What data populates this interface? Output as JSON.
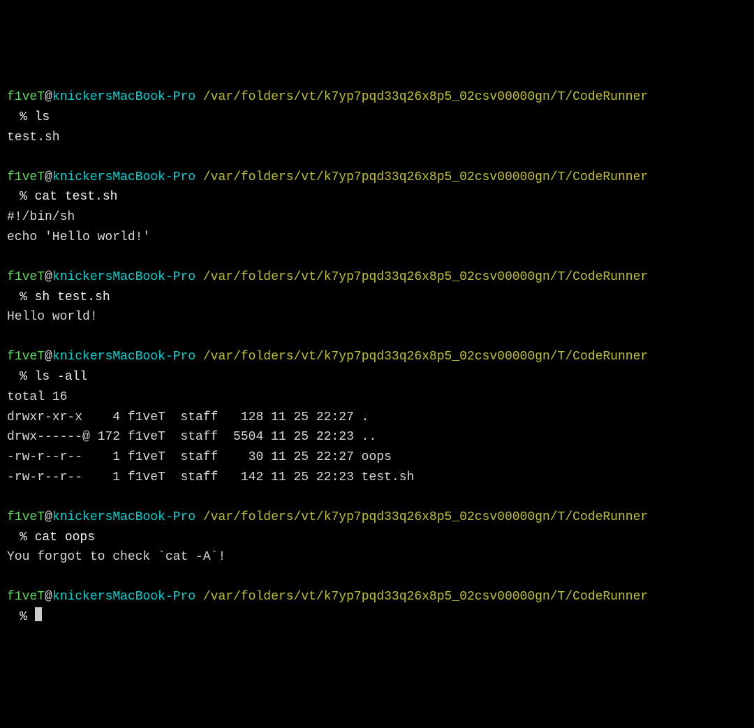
{
  "prompt": {
    "user": "f1veT",
    "at": "@",
    "host": "knickersMacBook-Pro",
    "path": "/var/folders/vt/k7yp7pqd33q26x8p5_02csv00000gn/T/CodeRunner",
    "symbol": "%"
  },
  "blocks": [
    {
      "cmd": "ls",
      "out": [
        "test.sh"
      ]
    },
    {
      "cmd": "cat test.sh",
      "out": [
        "#!/bin/sh",
        "echo 'Hello world!'"
      ]
    },
    {
      "cmd": "sh test.sh",
      "out": [
        "Hello world!"
      ]
    },
    {
      "cmd": "ls -all",
      "out": [
        "total 16",
        "drwxr-xr-x    4 f1veT  staff   128 11 25 22:27 .",
        "drwx------@ 172 f1veT  staff  5504 11 25 22:23 ..",
        "-rw-r--r--    1 f1veT  staff    30 11 25 22:27 oops",
        "-rw-r--r--    1 f1veT  staff   142 11 25 22:23 test.sh"
      ]
    },
    {
      "cmd": "cat oops",
      "out": [
        "You forgot to check `cat -A`!"
      ]
    },
    {
      "cmd": "",
      "out": []
    }
  ]
}
